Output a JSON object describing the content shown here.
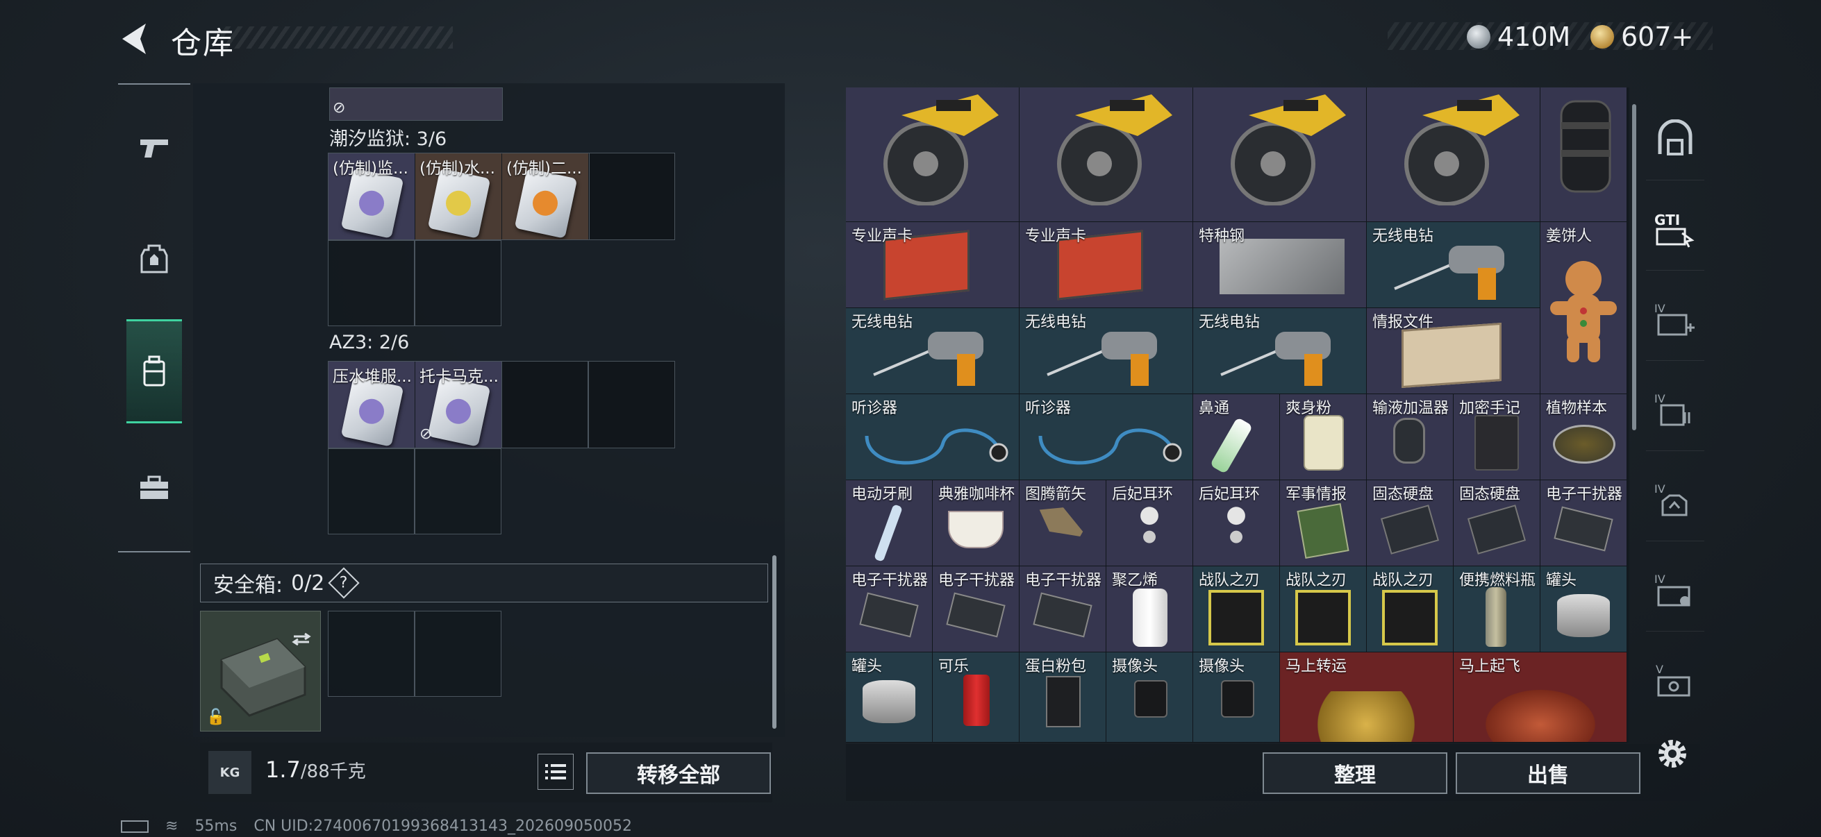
{
  "header": {
    "title": "仓库",
    "currencies": [
      {
        "icon": "silver-coin-icon",
        "value": "410M"
      },
      {
        "icon": "gold-coin-icon",
        "value": "607+"
      }
    ]
  },
  "left_tabs": [
    "pistol-icon",
    "backpack-icon",
    "rig-icon",
    "briefcase-icon"
  ],
  "groups": [
    {
      "label": "潮汐监狱: 3/6",
      "items": [
        "(仿制)监...",
        "(仿制)水...",
        "(仿制)二..."
      ]
    },
    {
      "label": "AZ3: 2/6",
      "items": [
        "压水堆服...",
        "托卡马克..."
      ]
    }
  ],
  "safe_box": {
    "label": "安全箱:",
    "count": "0/2",
    "help": "?"
  },
  "weight": {
    "current": "1.7",
    "max": "/88千克",
    "unit_icon": "KG"
  },
  "buttons": {
    "transfer_all": "转移全部",
    "organize": "整理",
    "sell": "出售"
  },
  "warehouse_items": [
    "专业声卡",
    "专业声卡",
    "特种钢",
    "无线电钻",
    "姜饼人",
    "无线电钻",
    "无线电钻",
    "无线电钻",
    "情报文件",
    "听诊器",
    "听诊器",
    "鼻通",
    "爽身粉",
    "输液加温器",
    "加密手记",
    "植物样本",
    "电动牙刷",
    "典雅咖啡杯",
    "图腾箭矢",
    "后妃耳环",
    "后妃耳环",
    "军事情报",
    "固态硬盘",
    "固态硬盘",
    "电子干扰器",
    "电子干扰器",
    "电子干扰器",
    "电子干扰器",
    "聚乙烯",
    "战队之刃",
    "战队之刃",
    "战队之刃",
    "便携燃料瓶",
    "罐头",
    "罐头",
    "可乐",
    "蛋白粉包",
    "摄像头",
    "摄像头",
    "马上转运",
    "马上起飞"
  ],
  "right_sidebar": [
    "vault-icon",
    "gti-icon",
    "level-iv-medkit-icon",
    "level-iv-gear-icon",
    "level-iv-backpack-icon",
    "level-iv-case-icon",
    "level-v-case-icon"
  ],
  "footer": {
    "ping": "55ms",
    "uid": "CN UID:2740067019936841314​3_202609050052"
  },
  "colors": {
    "accent": "#3fd3a0",
    "cell_purple": "#36364f",
    "cell_teal": "#243b47",
    "cell_red": "#6b2324"
  }
}
